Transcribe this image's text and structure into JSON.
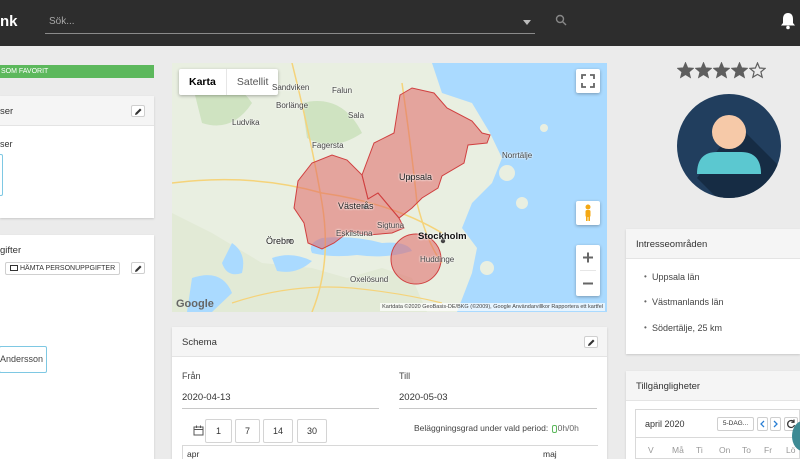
{
  "topbar": {
    "brand": "nk",
    "search_placeholder": "Sök..."
  },
  "left": {
    "favorite_badge": "SOM FAVORIT",
    "card1": {
      "title": "ser",
      "field_label": "ser"
    },
    "card2": {
      "title": "gifter",
      "fetch_button": "HÄMTA PERSONUPPGIFTER"
    },
    "contact_button": "Andersson"
  },
  "map": {
    "type_map": "Karta",
    "type_satellite": "Satellit",
    "labels": {
      "stockholm": "Stockholm",
      "uppsala": "Uppsala",
      "vasteras": "Västerås",
      "orebro": "Örebro",
      "eskilstuna": "Eskilstuna",
      "huddinge": "Huddinge",
      "sala": "Sala",
      "sandviken": "Sandviken",
      "borlange": "Borlänge",
      "falun": "Falun",
      "ludvika": "Ludvika",
      "fagersta": "Fagersta",
      "sigtuna": "Sigtuna",
      "norrtalje": "Norrtälje",
      "oxelosund": "Oxelösund"
    },
    "attribution": "Kartdata ©2020 GeoBasis-DE/BKG (©2009), Google   Användarvillkor   Rapportera ett kartfel",
    "google": "Google"
  },
  "schema": {
    "title": "Schema",
    "from_label": "Från",
    "from_value": "2020-04-13",
    "to_label": "Till",
    "to_value": "2020-05-03",
    "ranges": [
      "1",
      "7",
      "14",
      "30"
    ],
    "occupancy_label": "Beläggningsgrad under vald period:",
    "occupancy_value": "0h/0h",
    "months": [
      "apr",
      "maj"
    ]
  },
  "profile": {
    "rating": 4,
    "rating_max": 5
  },
  "interests": {
    "title": "Intresseområden",
    "items": [
      "Uppsala län",
      "Västmanlands län",
      "Södertälje, 25 km"
    ]
  },
  "availability": {
    "title": "Tillgängligheter",
    "month": "april 2020",
    "view_button": "5-DAG...",
    "weekdays": [
      "V",
      "Må",
      "Ti",
      "On",
      "To",
      "Fr",
      "Lö"
    ]
  },
  "colors": {
    "topbar": "#2d2d2d",
    "favorite": "#5cb85c",
    "region_fill": "#e06666",
    "avatar_bg": "#213e5e",
    "avatar_skin": "#f6c9a8",
    "avatar_shirt": "#5bc8d0"
  }
}
